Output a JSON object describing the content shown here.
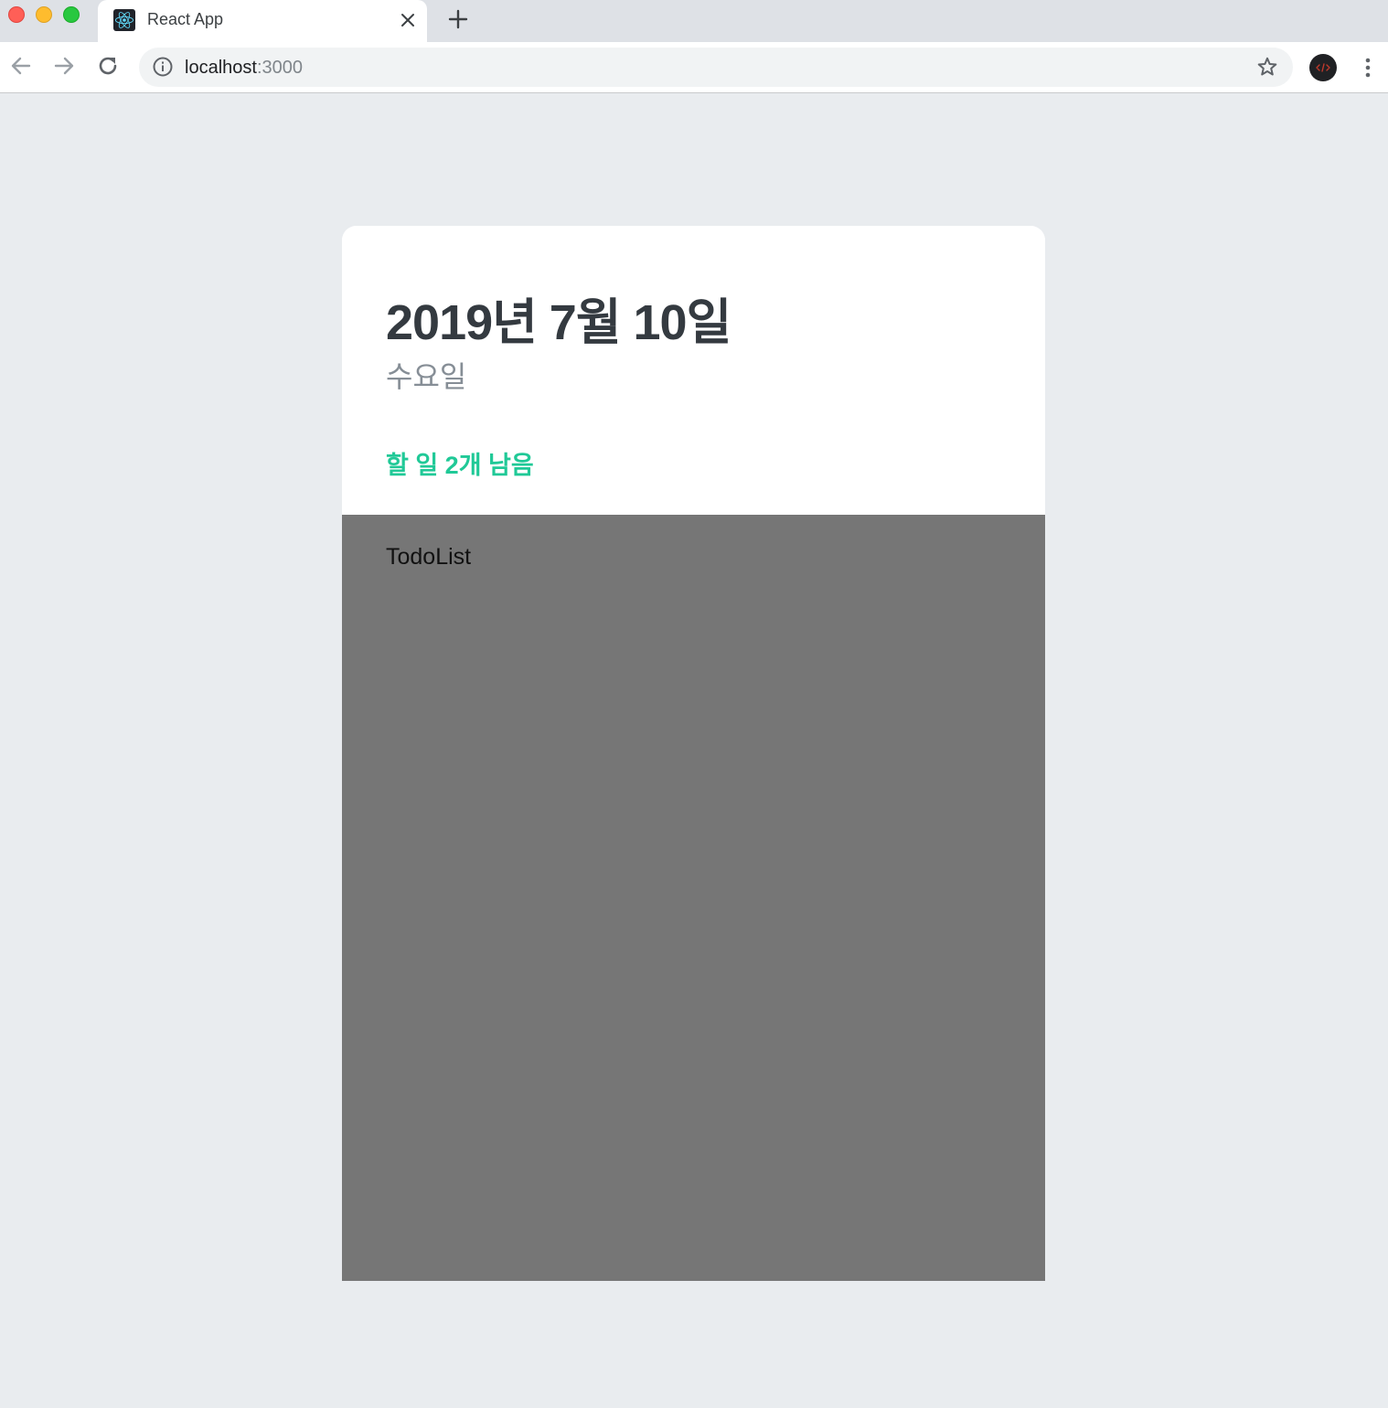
{
  "browser": {
    "tab": {
      "title": "React App",
      "favicon": "react-logo-icon"
    },
    "address_bar": {
      "host": "localhost",
      "port": ":3000"
    },
    "icons": {
      "back": "arrow-left-icon",
      "forward": "arrow-right-icon",
      "reload": "reload-icon",
      "info": "info-icon",
      "bookmark": "star-icon",
      "menu": "more-vert-icon",
      "close_tab": "close-icon",
      "new_tab": "plus-icon"
    }
  },
  "todo": {
    "date_title": "2019년 7월 10일",
    "day": "수요일",
    "tasks_left": "할 일 2개 남음",
    "list_label": "TodoList"
  },
  "colors": {
    "page_bg": "#e9ecef",
    "card_bg": "#ffffff",
    "title": "#343a40",
    "day": "#868e96",
    "accent": "#20c997",
    "list_bg": "#767676"
  }
}
